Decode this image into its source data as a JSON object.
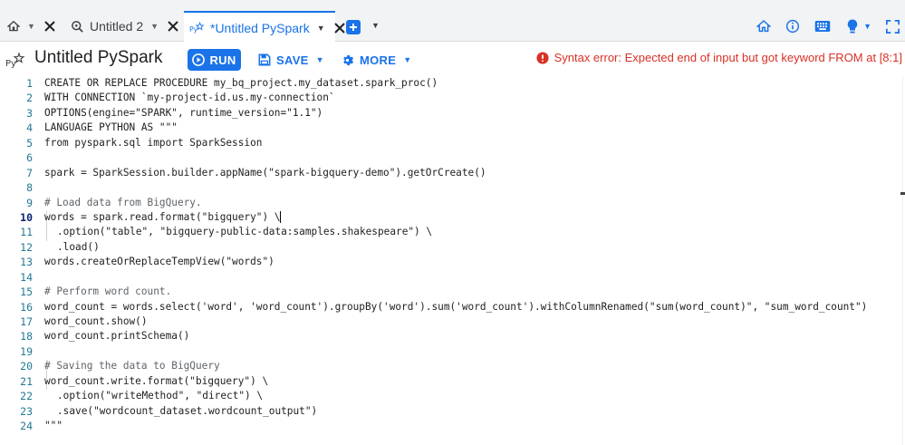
{
  "tabs": {
    "home": {
      "icon": "home-icon"
    },
    "untitled2": {
      "label": "Untitled 2",
      "icon": "query-search-icon"
    },
    "active": {
      "label": "*Untitled PySpark",
      "icon": "pyspark-icon"
    }
  },
  "toolbar": {
    "title": "Untitled PySpark",
    "run_label": "RUN",
    "save_label": "SAVE",
    "more_label": "MORE",
    "error_text": "Syntax error: Expected end of input but got keyword FROM at [8:1]"
  },
  "editor": {
    "active_line": 10,
    "lines": [
      "CREATE OR REPLACE PROCEDURE my_bq_project.my_dataset.spark_proc()",
      "WITH CONNECTION `my-project-id.us.my-connection`",
      "OPTIONS(engine=\"SPARK\", runtime_version=\"1.1\")",
      "LANGUAGE PYTHON AS \"\"\"",
      "from pyspark.sql import SparkSession",
      "",
      "spark = SparkSession.builder.appName(\"spark-bigquery-demo\").getOrCreate()",
      "",
      "# Load data from BigQuery.",
      "words = spark.read.format(\"bigquery\") \\",
      ".option(\"table\", \"bigquery-public-data:samples.shakespeare\") \\",
      ".load()",
      "words.createOrReplaceTempView(\"words\")",
      "",
      "# Perform word count.",
      "word_count = words.select('word', 'word_count').groupBy('word').sum('word_count').withColumnRenamed(\"sum(word_count)\", \"sum_word_count\")",
      "word_count.show()",
      "word_count.printSchema()",
      "",
      "# Saving the data to BigQuery",
      "word_count.write.format(\"bigquery\") \\",
      ".option(\"writeMethod\", \"direct\") \\",
      ".save(\"wordcount_dataset.wordcount_output\")",
      "\"\"\""
    ],
    "line_numbers": [
      "1",
      "2",
      "3",
      "4",
      "5",
      "6",
      "7",
      "8",
      "9",
      "10",
      "11",
      "12",
      "13",
      "14",
      "15",
      "16",
      "17",
      "18",
      "19",
      "20",
      "21",
      "22",
      "23",
      "24"
    ]
  },
  "colors": {
    "accent": "#1a73e8",
    "error": "#d93025",
    "line_number": "#237893",
    "comment": "#5f6368"
  }
}
